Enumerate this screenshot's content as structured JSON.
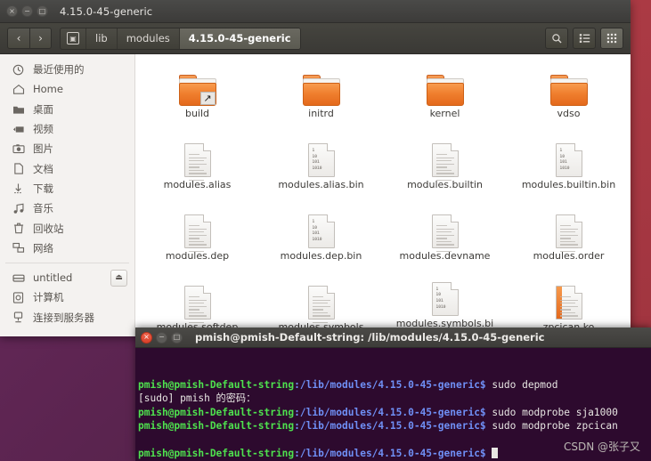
{
  "desktop": {
    "background_color": "#5e2750",
    "panel_color": "#a83741"
  },
  "file_manager": {
    "window_title": "4.15.0-45-generic",
    "window_buttons": {
      "close": "×",
      "minimize": "−",
      "maximize": "□"
    },
    "nav": {
      "back": "‹",
      "forward": "›"
    },
    "breadcrumbs": [
      {
        "label": "",
        "icon": "computer-icon",
        "active": false
      },
      {
        "label": "lib",
        "active": false
      },
      {
        "label": "modules",
        "active": false
      },
      {
        "label": "4.15.0-45-generic",
        "active": true
      }
    ],
    "toolbar_buttons": [
      {
        "name": "search-icon",
        "glyph": "⚲",
        "active": false
      },
      {
        "name": "list-view-icon",
        "glyph": "☰",
        "active": false
      },
      {
        "name": "grid-view-icon",
        "glyph": "⋮⋮",
        "active": true
      }
    ],
    "sidebar": {
      "items": [
        {
          "label": "最近使用的",
          "icon": "clock-icon",
          "glyph": "◴"
        },
        {
          "label": "Home",
          "icon": "home-icon",
          "glyph": "⌂"
        },
        {
          "label": "桌面",
          "icon": "folder-icon",
          "glyph": "▰"
        },
        {
          "label": "视频",
          "icon": "video-icon",
          "glyph": "▸■"
        },
        {
          "label": "图片",
          "icon": "camera-icon",
          "glyph": "▣"
        },
        {
          "label": "文档",
          "icon": "document-icon",
          "glyph": "⬚"
        },
        {
          "label": "下载",
          "icon": "download-icon",
          "glyph": "↓"
        },
        {
          "label": "音乐",
          "icon": "music-icon",
          "glyph": "♫"
        },
        {
          "label": "回收站",
          "icon": "trash-icon",
          "glyph": "⌧"
        },
        {
          "label": "网络",
          "icon": "network-icon",
          "glyph": "⧉"
        }
      ],
      "devices": [
        {
          "label": "untitled",
          "icon": "drive-icon",
          "glyph": "▬",
          "eject": true,
          "eject_glyph": "⏏"
        },
        {
          "label": "计算机",
          "icon": "computer-icon",
          "glyph": "▣",
          "eject": false
        },
        {
          "label": "连接到服务器",
          "icon": "connect-server-icon",
          "glyph": "⚱",
          "eject": false
        }
      ]
    },
    "files": [
      {
        "name": "build",
        "type": "folder",
        "symlink": true
      },
      {
        "name": "initrd",
        "type": "folder",
        "symlink": false
      },
      {
        "name": "kernel",
        "type": "folder",
        "symlink": false
      },
      {
        "name": "vdso",
        "type": "folder",
        "symlink": false
      },
      {
        "name": "modules.alias",
        "type": "text"
      },
      {
        "name": "modules.alias.bin",
        "type": "binary"
      },
      {
        "name": "modules.builtin",
        "type": "text"
      },
      {
        "name": "modules.builtin.bin",
        "type": "binary"
      },
      {
        "name": "modules.dep",
        "type": "text"
      },
      {
        "name": "modules.dep.bin",
        "type": "binary"
      },
      {
        "name": "modules.devname",
        "type": "text"
      },
      {
        "name": "modules.order",
        "type": "text"
      },
      {
        "name": "modules.softdep",
        "type": "text"
      },
      {
        "name": "modules.symbols",
        "type": "text"
      },
      {
        "name": "modules.symbols.bin",
        "type": "binary"
      },
      {
        "name": "zpcican.ko",
        "type": "module"
      }
    ],
    "binary_icon_digits": "1\n10\n101\n1010"
  },
  "terminal": {
    "window_title": "pmish@pmish-Default-string: /lib/modules/4.15.0-45-generic",
    "window_buttons": {
      "close": "×",
      "minimize": "−",
      "maximize": "□"
    },
    "prompt_user": "pmish@pmish-Default-string",
    "prompt_path": ":/lib/modules/4.15.0-45-generic$",
    "lines": [
      {
        "type": "prompt",
        "command": " sudo depmod"
      },
      {
        "type": "plain",
        "text": "[sudo] pmish 的密码："
      },
      {
        "type": "prompt",
        "command": " sudo modprobe sja1000"
      },
      {
        "type": "prompt",
        "command": " sudo modprobe zpcican"
      },
      {
        "type": "blank",
        "text": ""
      },
      {
        "type": "prompt-cursor",
        "command": " "
      }
    ],
    "watermark": "CSDN @张子又"
  }
}
